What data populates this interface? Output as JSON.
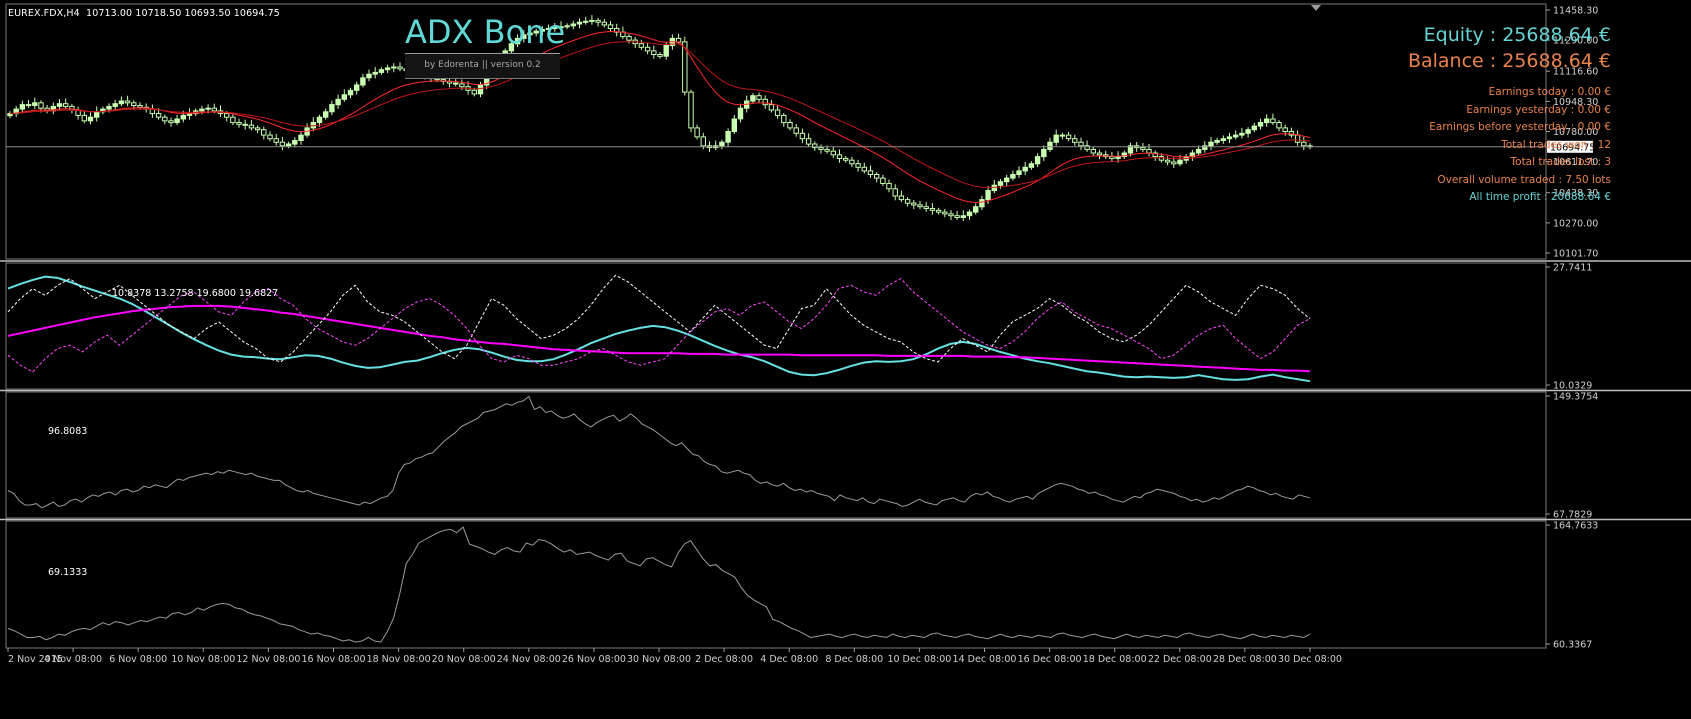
{
  "chart_header": {
    "symbol_label": "EUREX.FDX,H4",
    "ohlc": "10713.00 10718.50 10693.50 10694.75"
  },
  "indicator_panel": {
    "title": "ADX Bone",
    "subtitle": "by Edorenta || version 0.2"
  },
  "account_stats": {
    "equity": "Equity : 25688.64 €",
    "balance": "Balance : 25688.64 €",
    "lines": [
      "Earnings today : 0.00 €",
      "Earnings yesterday : 0.00 €",
      "Earnings before yesterday : 0.00 €",
      "Total trades won : 12",
      "Total trades lost : 3",
      "Overall volume traded : 7.50 lots"
    ],
    "profit": "All time profit : 20688.64 €"
  },
  "colors": {
    "background": "#000000",
    "candle_bull": "#c8ffb0",
    "candle_bear": "#c8ffb0",
    "ma_fast": "#ff2a2a",
    "ma_slow": "#c01818",
    "adx": "#66e0e0",
    "adx_ma": "#ff00ff",
    "di_plus": "#ffffff",
    "di_minus": "#ff44ff",
    "sub_line": "#9a9a9a",
    "grid_border": "#7a7a7a",
    "stat_orange": "#e8834a",
    "stat_cyan": "#66d4d4"
  },
  "chart_data": [
    {
      "type": "candlestick",
      "name": "EUREX.FDX,H4",
      "ylim": [
        10101.7,
        11458.3
      ],
      "y_ticks": [
        "11458.30",
        "11290.00",
        "11116.60",
        "10948.30",
        "10780.00",
        "10611.70",
        "10438.30",
        "10270.00",
        "10101.70"
      ],
      "current_price": "10694.75",
      "close": [
        10880,
        10905,
        10930,
        10925,
        10940,
        10910,
        10895,
        10920,
        10935,
        10920,
        10900,
        10870,
        10840,
        10860,
        10890,
        10905,
        10920,
        10935,
        10950,
        10940,
        10925,
        10915,
        10905,
        10880,
        10860,
        10840,
        10830,
        10850,
        10870,
        10880,
        10895,
        10905,
        10910,
        10895,
        10880,
        10860,
        10830,
        10820,
        10815,
        10800,
        10790,
        10760,
        10740,
        10720,
        10700,
        10710,
        10730,
        10760,
        10800,
        10830,
        10860,
        10890,
        10930,
        10960,
        10985,
        11010,
        11040,
        11080,
        11100,
        11110,
        11125,
        11135,
        11140,
        11130,
        11120,
        11110,
        11100,
        11090,
        11080,
        11070,
        11060,
        11050,
        11045,
        11030,
        11010,
        10990,
        11040,
        11090,
        11140,
        11190,
        11230,
        11270,
        11300,
        11320,
        11330,
        11340,
        11350,
        11355,
        11360,
        11365,
        11370,
        11380,
        11390,
        11395,
        11400,
        11390,
        11375,
        11355,
        11335,
        11310,
        11290,
        11270,
        11250,
        11230,
        11210,
        11200,
        11260,
        11300,
        11280,
        11000,
        10800,
        10750,
        10700,
        10690,
        10700,
        10720,
        10780,
        10850,
        10910,
        10950,
        10980,
        10960,
        10930,
        10900,
        10870,
        10830,
        10800,
        10770,
        10740,
        10710,
        10690,
        10680,
        10670,
        10650,
        10630,
        10620,
        10600,
        10580,
        10560,
        10540,
        10520,
        10490,
        10460,
        10420,
        10400,
        10380,
        10370,
        10360,
        10350,
        10340,
        10330,
        10320,
        10310,
        10300,
        10310,
        10330,
        10360,
        10400,
        10450,
        10480,
        10500,
        10520,
        10540,
        10560,
        10580,
        10600,
        10640,
        10680,
        10720,
        10760,
        10760,
        10740,
        10720,
        10700,
        10680,
        10660,
        10650,
        10640,
        10630,
        10640,
        10660,
        10700,
        10690,
        10680,
        10660,
        10640,
        10620,
        10610,
        10600,
        10620,
        10640,
        10660,
        10680,
        10700,
        10720,
        10730,
        10740,
        10750,
        10760,
        10770,
        10790,
        10810,
        10830,
        10850,
        10830,
        10800,
        10780,
        10760,
        10720,
        10700,
        10695
      ]
    },
    {
      "type": "line",
      "name": "ADX subwindow",
      "readout": "10.8378 13.2758 19.6800 19.6827",
      "ylim": [
        10.0329,
        27.7411
      ],
      "y_ticks": [
        "27.7411",
        "10.0329"
      ],
      "series": [
        {
          "role": "adx",
          "values": [
            24.5,
            25.2,
            25.8,
            26.3,
            26.1,
            25.5,
            24.8,
            24.2,
            23.6,
            23.0,
            22.2,
            21.2,
            20.1,
            19.0,
            17.9,
            16.9,
            16.0,
            15.2,
            14.6,
            14.3,
            14.2,
            14.0,
            13.9,
            14.2,
            14.5,
            14.4,
            14.0,
            13.4,
            12.9,
            12.6,
            12.7,
            13.1,
            13.5,
            13.7,
            14.2,
            14.8,
            15.3,
            15.6,
            15.4,
            14.9,
            14.3,
            13.8,
            13.6,
            13.6,
            13.9,
            14.6,
            15.4,
            16.3,
            17.0,
            17.7,
            18.2,
            18.6,
            18.9,
            18.7,
            18.2,
            17.5,
            16.7,
            15.9,
            15.2,
            14.6,
            14.2,
            13.6,
            12.8,
            12.0,
            11.6,
            11.5,
            11.8,
            12.3,
            12.9,
            13.4,
            13.6,
            13.5,
            13.6,
            13.9,
            14.6,
            15.5,
            16.2,
            16.5,
            16.2,
            15.6,
            15.0,
            14.5,
            14.0,
            13.6,
            13.3,
            12.9,
            12.5,
            12.1,
            11.9,
            11.6,
            11.3,
            11.2,
            11.3,
            11.2,
            11.1,
            11.2,
            11.5,
            11.2,
            10.9,
            10.8,
            10.9,
            11.3,
            11.6,
            11.2,
            10.9,
            10.6
          ]
        },
        {
          "role": "adx_ma",
          "values": [
            17.4,
            17.8,
            18.2,
            18.6,
            19.0,
            19.4,
            19.8,
            20.2,
            20.5,
            20.8,
            21.1,
            21.3,
            21.5,
            21.7,
            21.8,
            21.9,
            21.9,
            21.9,
            21.8,
            21.6,
            21.4,
            21.2,
            20.9,
            20.7,
            20.4,
            20.1,
            19.8,
            19.5,
            19.2,
            18.9,
            18.6,
            18.3,
            18.0,
            17.7,
            17.4,
            17.2,
            16.9,
            16.7,
            16.5,
            16.3,
            16.2,
            16.0,
            15.8,
            15.6,
            15.4,
            15.3,
            15.2,
            15.1,
            15.0,
            14.9,
            14.8,
            14.8,
            14.8,
            14.8,
            14.8,
            14.7,
            14.7,
            14.7,
            14.6,
            14.6,
            14.6,
            14.6,
            14.6,
            14.6,
            14.5,
            14.5,
            14.5,
            14.5,
            14.5,
            14.5,
            14.5,
            14.4,
            14.4,
            14.4,
            14.4,
            14.4,
            14.4,
            14.4,
            14.3,
            14.3,
            14.3,
            14.2,
            14.2,
            14.1,
            14.0,
            13.9,
            13.8,
            13.7,
            13.6,
            13.5,
            13.4,
            13.3,
            13.2,
            13.1,
            13.0,
            12.9,
            12.8,
            12.7,
            12.6,
            12.5,
            12.4,
            12.3,
            12.3,
            12.2,
            12.2,
            12.1
          ]
        },
        {
          "role": "di_plus",
          "values": [
            21.0,
            23.0,
            24.5,
            23.5,
            25.0,
            26.0,
            24.5,
            23.0,
            24.0,
            25.0,
            23.5,
            22.0,
            20.5,
            19.0,
            18.0,
            17.0,
            18.5,
            19.5,
            18.0,
            16.5,
            15.5,
            14.0,
            13.5,
            15.0,
            17.0,
            19.0,
            21.0,
            23.5,
            25.0,
            22.5,
            21.0,
            20.5,
            19.5,
            18.0,
            16.5,
            15.0,
            14.0,
            16.0,
            19.5,
            23.0,
            22.0,
            20.0,
            18.5,
            17.0,
            17.5,
            18.5,
            20.0,
            22.0,
            24.5,
            26.5,
            25.5,
            24.0,
            22.5,
            21.0,
            19.5,
            18.0,
            20.0,
            22.0,
            20.5,
            19.0,
            17.5,
            16.0,
            15.5,
            18.5,
            21.5,
            22.0,
            24.5,
            22.5,
            20.5,
            19.0,
            18.0,
            17.0,
            16.5,
            15.0,
            14.0,
            13.5,
            15.5,
            17.0,
            16.0,
            15.0,
            17.5,
            19.5,
            20.5,
            21.5,
            23.0,
            22.0,
            20.5,
            19.5,
            18.0,
            17.0,
            16.5,
            17.5,
            19.0,
            21.0,
            23.0,
            25.0,
            24.0,
            22.5,
            21.5,
            20.5,
            23.0,
            25.0,
            24.5,
            23.5,
            21.5,
            20.0
          ]
        },
        {
          "role": "di_minus",
          "values": [
            14.5,
            13.0,
            12.0,
            14.0,
            15.5,
            16.0,
            15.0,
            16.5,
            17.5,
            16.0,
            17.5,
            19.0,
            20.5,
            22.0,
            23.5,
            24.0,
            22.5,
            21.0,
            20.5,
            22.5,
            24.0,
            24.5,
            23.0,
            22.0,
            20.0,
            18.5,
            17.5,
            16.5,
            16.0,
            17.0,
            18.5,
            20.0,
            21.5,
            22.5,
            23.0,
            22.0,
            20.5,
            18.5,
            16.0,
            14.0,
            13.5,
            14.5,
            14.0,
            13.0,
            13.0,
            13.5,
            14.0,
            15.0,
            15.5,
            14.5,
            13.5,
            13.0,
            13.5,
            14.0,
            16.0,
            18.0,
            19.5,
            21.0,
            21.5,
            20.5,
            22.0,
            22.5,
            21.0,
            19.5,
            18.5,
            20.0,
            22.0,
            24.5,
            25.0,
            24.0,
            23.5,
            25.0,
            26.0,
            24.0,
            22.5,
            21.0,
            19.5,
            18.0,
            17.0,
            16.0,
            15.5,
            16.5,
            18.0,
            20.0,
            21.5,
            22.5,
            21.0,
            20.0,
            19.0,
            18.5,
            17.5,
            16.5,
            15.5,
            14.0,
            14.5,
            16.0,
            17.5,
            18.5,
            19.0,
            17.0,
            15.5,
            14.0,
            15.0,
            17.0,
            19.0,
            20.0
          ]
        }
      ]
    },
    {
      "type": "line",
      "name": "subwindow 2",
      "readout": "96.8083",
      "ylim": [
        67.7829,
        149.3754
      ],
      "y_ticks": [
        "149.3754",
        "67.7829"
      ],
      "values": [
        84,
        82,
        77,
        74,
        74,
        75,
        72,
        74,
        76,
        73,
        74,
        77,
        78,
        76,
        79,
        81,
        80,
        82,
        83,
        81,
        84,
        85,
        83,
        84,
        87,
        86,
        88,
        87,
        86,
        89,
        92,
        91,
        93,
        94,
        95,
        96,
        95,
        97,
        96,
        98,
        97,
        96,
        95,
        96,
        94,
        93,
        92,
        91,
        91,
        88,
        86,
        84,
        83,
        84,
        82,
        81,
        80,
        79,
        78,
        77,
        76,
        75,
        74,
        76,
        75,
        77,
        79,
        80,
        84,
        96,
        102,
        103,
        106,
        107,
        109,
        110,
        114,
        118,
        121,
        124,
        128,
        130,
        132,
        134,
        138,
        139,
        140,
        142,
        144,
        143,
        145,
        146,
        149,
        140,
        142,
        138,
        139,
        136,
        134,
        135,
        137,
        133,
        130,
        128,
        131,
        133,
        135,
        136,
        132,
        134,
        137,
        134,
        130,
        128,
        126,
        123,
        120,
        117,
        115,
        117,
        113,
        109,
        108,
        104,
        102,
        101,
        97,
        96,
        97,
        98,
        96,
        95,
        91,
        89,
        90,
        88,
        87,
        89,
        86,
        84,
        85,
        83,
        84,
        82,
        81,
        80,
        77,
        81,
        79,
        78,
        77,
        79,
        76,
        75,
        78,
        77,
        76,
        75,
        73,
        74,
        76,
        78,
        76,
        75,
        74,
        77,
        78,
        79,
        77,
        76,
        80,
        82,
        81,
        83,
        80,
        79,
        77,
        76,
        78,
        79,
        80,
        78,
        82,
        84,
        86,
        88,
        89,
        88,
        87,
        85,
        84,
        82,
        83,
        81,
        80,
        78,
        77,
        76,
        78,
        80,
        79,
        82,
        83,
        85,
        84,
        83,
        82,
        80,
        79,
        77,
        78,
        76,
        77,
        79,
        78,
        80,
        82,
        84,
        85,
        87,
        86,
        84,
        83,
        81,
        82,
        80,
        79,
        78,
        81,
        80,
        79
      ]
    },
    {
      "type": "line",
      "name": "subwindow 3",
      "readout": "69.1333",
      "ylim": [
        60.3367,
        164.7633
      ],
      "y_ticks": [
        "164.7633",
        "60.3367"
      ],
      "values": [
        74,
        72,
        69,
        66,
        66,
        67,
        64,
        66,
        69,
        68,
        71,
        73,
        74,
        73,
        76,
        79,
        77,
        80,
        79,
        77,
        79,
        81,
        80,
        82,
        84,
        83,
        87,
        88,
        86,
        88,
        92,
        90,
        93,
        95,
        96,
        95,
        92,
        91,
        88,
        86,
        85,
        83,
        81,
        78,
        77,
        76,
        73,
        71,
        69,
        70,
        68,
        67,
        65,
        63,
        64,
        62,
        63,
        66,
        63,
        62,
        71,
        83,
        105,
        131,
        139,
        149,
        152,
        155,
        158,
        160,
        161,
        158,
        163,
        148,
        146,
        144,
        141,
        139,
        143,
        145,
        142,
        141,
        149,
        147,
        152,
        151,
        148,
        144,
        141,
        143,
        139,
        140,
        141,
        138,
        136,
        134,
        139,
        140,
        133,
        131,
        129,
        135,
        136,
        133,
        130,
        128,
        140,
        148,
        151,
        143,
        135,
        129,
        130,
        125,
        122,
        119,
        110,
        103,
        99,
        96,
        93,
        82,
        80,
        77,
        74,
        72,
        69,
        66,
        67,
        68,
        69,
        67,
        66,
        68,
        69,
        67,
        66,
        68,
        67,
        66,
        69,
        67,
        66,
        68,
        67,
        66,
        69,
        70,
        68,
        67,
        66,
        68,
        69,
        67,
        66,
        65,
        67,
        69,
        67,
        66,
        68,
        67,
        66,
        68,
        67,
        66,
        69,
        70,
        68,
        67,
        66,
        68,
        69,
        67,
        66,
        65,
        67,
        69,
        67,
        66,
        68,
        67,
        66,
        68,
        67,
        66,
        69,
        70,
        68,
        67,
        66,
        68,
        69,
        67,
        66,
        65,
        67,
        69,
        67,
        66,
        68,
        67,
        66,
        68,
        67,
        66,
        69
      ]
    }
  ],
  "time_axis": [
    "2 Nov 2015",
    "4 Nov 08:00",
    "6 Nov 08:00",
    "10 Nov 08:00",
    "12 Nov 08:00",
    "16 Nov 08:00",
    "18 Nov 08:00",
    "20 Nov 08:00",
    "24 Nov 08:00",
    "26 Nov 08:00",
    "30 Nov 08:00",
    "2 Dec 08:00",
    "4 Dec 08:00",
    "8 Dec 08:00",
    "10 Dec 08:00",
    "14 Dec 08:00",
    "16 Dec 08:00",
    "18 Dec 08:00",
    "22 Dec 08:00",
    "28 Dec 08:00",
    "30 Dec 08:00"
  ]
}
